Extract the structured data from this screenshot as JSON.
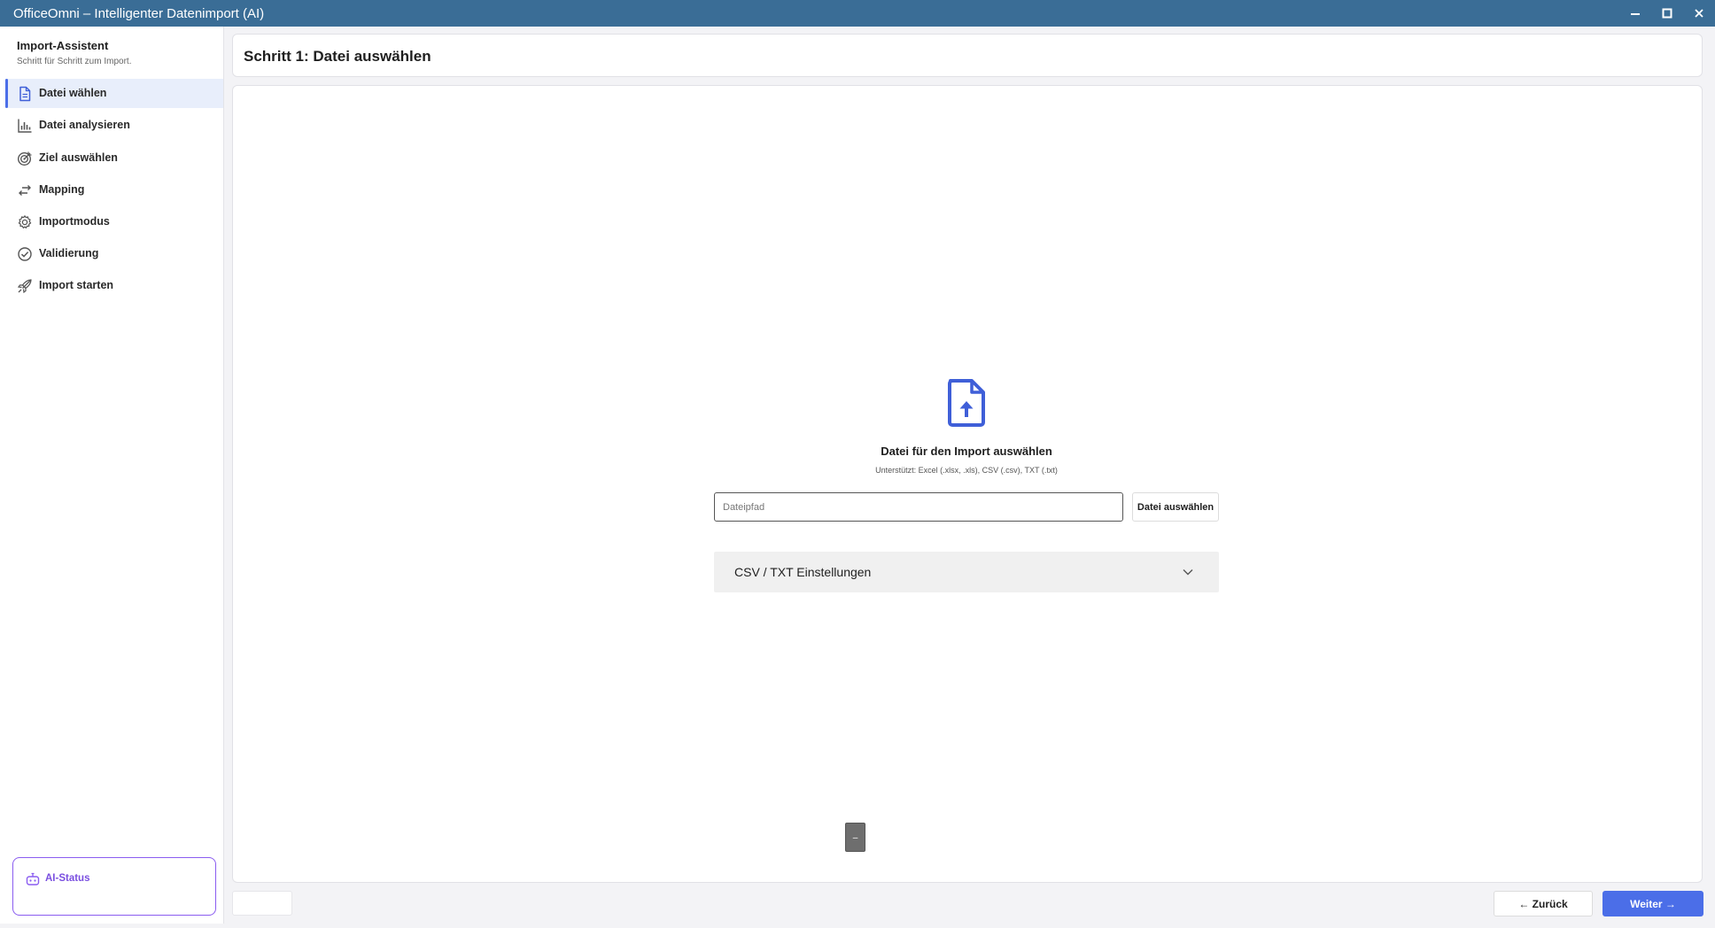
{
  "window": {
    "title": "OfficeOmni – Intelligenter Datenimport (AI)",
    "controls": [
      "minimize-icon",
      "maximize-icon",
      "close-icon"
    ]
  },
  "sidebar": {
    "title": "Import-Assistent",
    "subtitle": "Schritt für Schritt zum Import.",
    "items": [
      {
        "label": "Datei wählen",
        "icon": "file-icon",
        "active": true
      },
      {
        "label": "Datei analysieren",
        "icon": "bar-chart-icon",
        "active": false
      },
      {
        "label": "Ziel auswählen",
        "icon": "target-icon",
        "active": false
      },
      {
        "label": "Mapping",
        "icon": "arrows-swap-icon",
        "active": false
      },
      {
        "label": "Importmodus",
        "icon": "gear-icon",
        "active": false
      },
      {
        "label": "Validierung",
        "icon": "check-circle-icon",
        "active": false
      },
      {
        "label": "Import starten",
        "icon": "rocket-icon",
        "active": false
      }
    ],
    "ai_status": {
      "label": "AI-Status",
      "icon": "robot-icon"
    }
  },
  "main": {
    "step_title": "Schritt 1: Datei auswählen",
    "upload": {
      "icon": "file-upload-icon",
      "title": "Datei für den Import auswählen",
      "subtitle": "Unterstützt: Excel (.xlsx, .xls), CSV (.csv), TXT (.txt)",
      "input_placeholder": "Dateipfad",
      "input_value": "",
      "choose_button": "Datei auswählen"
    },
    "csv_settings": {
      "label": "CSV / TXT Einstellungen",
      "icon": "chevron-down-icon",
      "expanded": false
    },
    "tiny_button": "–"
  },
  "footer": {
    "back_button": "← Zurück",
    "next_button": "Weiter →"
  },
  "colors": {
    "titlebar": "#3a6d96",
    "accent": "#4b6ee8",
    "ai_accent": "#8a5cf0",
    "active_nav_bg": "#e8eefb"
  }
}
